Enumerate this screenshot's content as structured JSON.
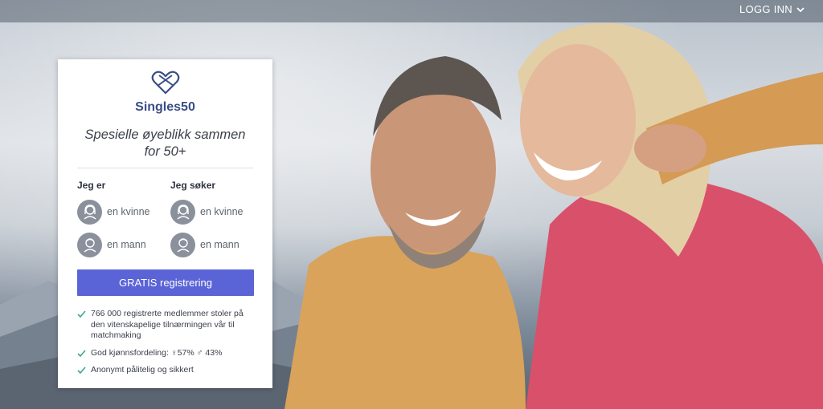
{
  "header": {
    "login_label": "LOGG INN"
  },
  "brand": {
    "name": "Singles50",
    "accent_color": "#3a4e86"
  },
  "signup": {
    "tagline": "Spesielle øyeblikk sammen for 50+",
    "i_am": {
      "heading": "Jeg er",
      "options": [
        {
          "label": "en kvinne",
          "icon": "woman-avatar-icon"
        },
        {
          "label": "en mann",
          "icon": "man-avatar-icon"
        }
      ]
    },
    "seeking": {
      "heading": "Jeg søker",
      "options": [
        {
          "label": "en kvinne",
          "icon": "woman-avatar-icon"
        },
        {
          "label": "en mann",
          "icon": "man-avatar-icon"
        }
      ]
    },
    "cta_label": "GRATIS registrering",
    "cta_color": "#5b64d6",
    "benefits": [
      "766 000 registrerte medlemmer stoler på den vitenskapelige tilnærmingen vår til matchmaking",
      "God kjønnsfordeling: ♀57% ♂ 43%",
      "Anonymt pålitelig og sikkert"
    ],
    "check_color": "#3aa88e"
  }
}
